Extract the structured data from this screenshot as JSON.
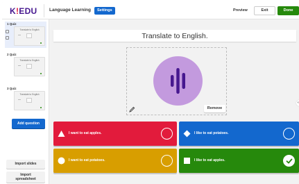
{
  "header": {
    "logo_main": "K",
    "logo_bang": "!",
    "logo_rest": "EDU",
    "title": "Language Learning",
    "settings_label": "Settings",
    "preview_label": "Preview",
    "exit_label": "Exit",
    "done_label": "Done"
  },
  "sidebar": {
    "slides": [
      {
        "number": "1 Quiz",
        "title": "Translate to English",
        "active": true
      },
      {
        "number": "2 Quiz",
        "title": "Translate to English",
        "active": false
      },
      {
        "number": "3 Quiz",
        "title": "Translate to English",
        "active": false
      }
    ],
    "add_question_label": "Add question",
    "import_slides_label": "Import slides",
    "import_sheet_line1": "Import",
    "import_sheet_line2": "spreadsheet"
  },
  "question": {
    "text": "Translate to English.",
    "media_icon": "sound-wave-icon",
    "remove_label": "Remove"
  },
  "answers": [
    {
      "text": "I want to eat apples.",
      "shape": "triangle-icon",
      "color": "#e21b3c",
      "correct": false
    },
    {
      "text": "I like to eat potatoes.",
      "shape": "diamond-icon",
      "color": "#1368ce",
      "correct": false
    },
    {
      "text": "I want to eat potatoes.",
      "shape": "circle-icon",
      "color": "#d89e00",
      "correct": false
    },
    {
      "text": "I like to eat apples.",
      "shape": "square-icon",
      "color": "#26890c",
      "correct": true
    }
  ],
  "colors": {
    "brand": "#46178f",
    "accent": "#1368ce",
    "done": "#26890c",
    "media": "#c39ade"
  }
}
